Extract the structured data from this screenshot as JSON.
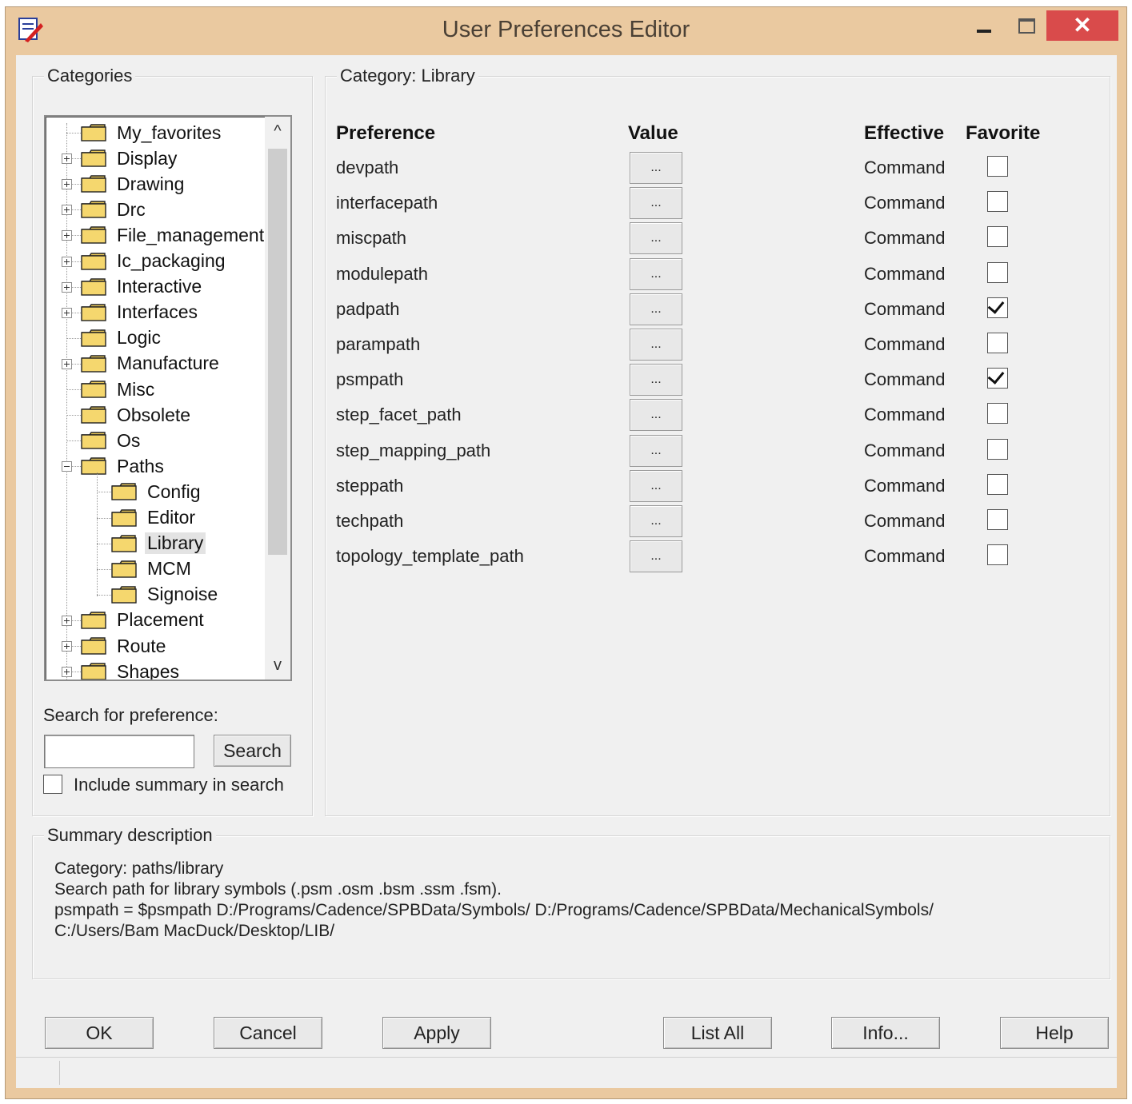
{
  "window": {
    "title": "User Preferences Editor",
    "close_glyph": "✕"
  },
  "categories": {
    "group_label": "Categories",
    "tree": [
      {
        "label": "My_favorites",
        "expander": "none",
        "level": 0
      },
      {
        "label": "Display",
        "expander": "plus",
        "level": 0
      },
      {
        "label": "Drawing",
        "expander": "plus",
        "level": 0
      },
      {
        "label": "Drc",
        "expander": "plus",
        "level": 0
      },
      {
        "label": "File_management",
        "expander": "plus",
        "level": 0
      },
      {
        "label": "Ic_packaging",
        "expander": "plus",
        "level": 0
      },
      {
        "label": "Interactive",
        "expander": "plus",
        "level": 0
      },
      {
        "label": "Interfaces",
        "expander": "plus",
        "level": 0
      },
      {
        "label": "Logic",
        "expander": "none",
        "level": 0
      },
      {
        "label": "Manufacture",
        "expander": "plus",
        "level": 0
      },
      {
        "label": "Misc",
        "expander": "none",
        "level": 0
      },
      {
        "label": "Obsolete",
        "expander": "none",
        "level": 0
      },
      {
        "label": "Os",
        "expander": "none",
        "level": 0
      },
      {
        "label": "Paths",
        "expander": "minus",
        "level": 0
      },
      {
        "label": "Config",
        "expander": "none",
        "level": 1
      },
      {
        "label": "Editor",
        "expander": "none",
        "level": 1
      },
      {
        "label": "Library",
        "expander": "none",
        "level": 1,
        "selected": true
      },
      {
        "label": "MCM",
        "expander": "none",
        "level": 1
      },
      {
        "label": "Signoise",
        "expander": "none",
        "level": 1
      },
      {
        "label": "Placement",
        "expander": "plus",
        "level": 0
      },
      {
        "label": "Route",
        "expander": "plus",
        "level": 0
      },
      {
        "label": "Shapes",
        "expander": "plus",
        "level": 0
      }
    ],
    "search_label": "Search for preference:",
    "search_value": "",
    "search_button": "Search",
    "include_summary_label": "Include summary in search",
    "include_summary_checked": false
  },
  "category_panel": {
    "group_label": "Category:   Library",
    "headers": {
      "preference": "Preference",
      "value": "Value",
      "effective": "Effective",
      "favorite": "Favorite"
    },
    "rows": [
      {
        "name": "devpath",
        "value_button": "...",
        "effective": "Command",
        "favorite": false
      },
      {
        "name": "interfacepath",
        "value_button": "...",
        "effective": "Command",
        "favorite": false
      },
      {
        "name": "miscpath",
        "value_button": "...",
        "effective": "Command",
        "favorite": false
      },
      {
        "name": "modulepath",
        "value_button": "...",
        "effective": "Command",
        "favorite": false
      },
      {
        "name": "padpath",
        "value_button": "...",
        "effective": "Command",
        "favorite": true
      },
      {
        "name": "parampath",
        "value_button": "...",
        "effective": "Command",
        "favorite": false
      },
      {
        "name": "psmpath",
        "value_button": "...",
        "effective": "Command",
        "favorite": true
      },
      {
        "name": "step_facet_path",
        "value_button": "...",
        "effective": "Command",
        "favorite": false
      },
      {
        "name": "step_mapping_path",
        "value_button": "...",
        "effective": "Command",
        "favorite": false
      },
      {
        "name": "steppath",
        "value_button": "...",
        "effective": "Command",
        "favorite": false
      },
      {
        "name": "techpath",
        "value_button": "...",
        "effective": "Command",
        "favorite": false
      },
      {
        "name": "topology_template_path",
        "value_button": "...",
        "effective": "Command",
        "favorite": false
      }
    ]
  },
  "summary": {
    "group_label": "Summary description",
    "lines": [
      "Category: paths/library",
      "Search path for library symbols (.psm .osm .bsm .ssm .fsm).",
      "psmpath = $psmpath D:/Programs/Cadence/SPBData/Symbols/ D:/Programs/Cadence/SPBData/MechanicalSymbols/",
      "C:/Users/Bam MacDuck/Desktop/LIB/"
    ]
  },
  "buttons": {
    "ok": "OK",
    "cancel": "Cancel",
    "apply": "Apply",
    "list_all": "List All",
    "info": "Info...",
    "help": "Help"
  },
  "icons": {
    "scroll_up": "^",
    "scroll_down": "v"
  },
  "colors": {
    "title_bar": "#eac9a0",
    "close_button": "#d94b4b",
    "folder": "#f5d76e"
  }
}
